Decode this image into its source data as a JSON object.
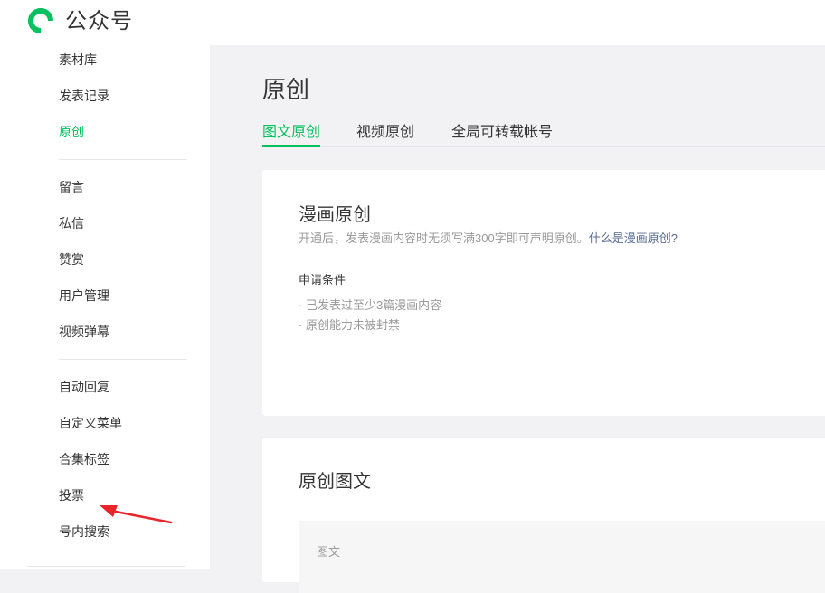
{
  "app": {
    "name": "公众号",
    "logo_icon": "wechat-official-account-logo-icon",
    "accent": "#07c160"
  },
  "sidebar": {
    "groups": [
      [
        {
          "label": "素材库"
        },
        {
          "label": "发表记录"
        },
        {
          "label": "原创",
          "active": true
        }
      ],
      [
        {
          "label": "留言"
        },
        {
          "label": "私信"
        },
        {
          "label": "赞赏"
        },
        {
          "label": "用户管理"
        },
        {
          "label": "视频弹幕"
        }
      ],
      [
        {
          "label": "自动回复"
        },
        {
          "label": "自定义菜单"
        },
        {
          "label": "合集标签"
        },
        {
          "label": "投票"
        },
        {
          "label": "号内搜索"
        }
      ]
    ],
    "annotation": {
      "icon": "red-arrow-icon",
      "color": "#e8262a"
    }
  },
  "main": {
    "title": "原创",
    "tabs": [
      {
        "label": "图文原创",
        "active": true
      },
      {
        "label": "视频原创"
      },
      {
        "label": "全局可转载帐号"
      }
    ],
    "comic_card": {
      "title": "漫画原创",
      "desc": "开通后，发表漫画内容时无须写满300字即可声明原创。",
      "desc_link": "什么是漫画原创?",
      "requirements_title": "申请条件",
      "requirements": [
        "· 已发表过至少3篇漫画内容",
        "· 原创能力未被封禁"
      ]
    },
    "original_card": {
      "title": "原创图文",
      "table_column": "图文"
    }
  }
}
